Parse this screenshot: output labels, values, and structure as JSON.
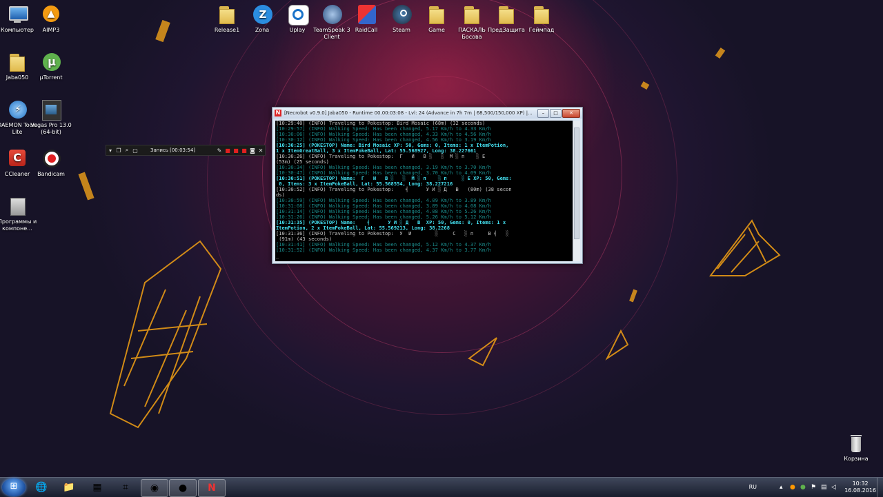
{
  "desktop": {
    "icons_left": [
      {
        "label": "Компьютер",
        "icon": "computer-icon"
      },
      {
        "label": "AIMP3",
        "icon": "aimp-icon"
      },
      {
        "label": "Jaba050",
        "icon": "folder-icon"
      },
      {
        "label": "µTorrent",
        "icon": "utorrent-icon"
      },
      {
        "label": "DAEMON Tools Lite",
        "icon": "daemon-tools-icon"
      },
      {
        "label": "Vegas Pro 13.0 (64-bit)",
        "icon": "vegas-icon"
      },
      {
        "label": "CCleaner",
        "icon": "ccleaner-icon"
      },
      {
        "label": "Bandicam",
        "icon": "bandicam-icon"
      },
      {
        "label": "Программы и компоне...",
        "icon": "programs-icon"
      }
    ],
    "icons_top": [
      {
        "label": "Release1",
        "icon": "folder-icon"
      },
      {
        "label": "Zona",
        "icon": "zona-icon"
      },
      {
        "label": "Uplay",
        "icon": "uplay-icon"
      },
      {
        "label": "TeamSpeak 3 Client",
        "icon": "teamspeak-icon"
      },
      {
        "label": "RaidCall",
        "icon": "raidcall-icon"
      },
      {
        "label": "Steam",
        "icon": "steam-icon"
      },
      {
        "label": "Game",
        "icon": "folder-icon"
      },
      {
        "label": "ПАСКАЛЬ Босова",
        "icon": "folder-icon"
      },
      {
        "label": "ПредЗащита",
        "icon": "folder-icon"
      },
      {
        "label": "Геймпад",
        "icon": "folder-icon"
      }
    ],
    "recycle_bin": {
      "label": "Корзина"
    }
  },
  "console_window": {
    "title": "[Necrobot v0.9.0] Jaba050 - Runtime 00.00:03:08 - Lvl: 24 (Advance in 7h 7m | 68,500/150,000 XP) |...",
    "lines": [
      {
        "text": "[10:29:40] (INFO) Traveling to Pokestop: Bird Mosaic (68m) (32 seconds)",
        "color": "white"
      },
      {
        "text": "[10:29:57] (INFO) Walking Speed: Has been changed, 5.17 Km/h to 4.33 Km/h",
        "color": "teal"
      },
      {
        "text": "[10:30:06] (INFO) Walking Speed: Has been changed, 4.33 Km/h to 4.56 Km/h",
        "color": "teal"
      },
      {
        "text": "[10:30:12] (INFO) Walking Speed: Has been changed, 4.56 Km/h to 3.19 Km/h",
        "color": "teal"
      },
      {
        "text": "[10:30:25] (POKESTOP) Name: Bird Mosaic XP: 50, Gems: 0, Items: 1 x ItemPotion,",
        "color": "cyan"
      },
      {
        "text": "1 x ItemGreatBall, 3 x ItemPokeBall, Lat: 55.568927, Long: 38.227661",
        "color": "cyan"
      },
      {
        "text": "[10:30:26] (INFO) Traveling to Pokestop:  Г   И   В ░   ░  М ░ п    ░ Е",
        "color": "white"
      },
      {
        "text": "(53m) (25 seconds)",
        "color": "white"
      },
      {
        "text": "[10:30:34] (INFO) Walking Speed: Has been changed, 3.19 Km/h to 3.70 Km/h",
        "color": "teal"
      },
      {
        "text": "[10:30:47] (INFO) Walking Speed: Has been changed, 3.70 Km/h to 4.09 Km/h",
        "color": "teal"
      },
      {
        "text": "[10:30:51] (POKESTOP) Name:  Г   И   В ░   ░  М ░ п    ░ п     ░ Е XP: 50, Gems:",
        "color": "cyan"
      },
      {
        "text": " 0, Items: 3 x ItemPokeBall, Lat: 55.568554, Long: 38.227216",
        "color": "cyan"
      },
      {
        "text": "[10:30:52] (INFO) Traveling to Pokestop:    ╡      У И ░ Д   В   (80m) (38 secon",
        "color": "white"
      },
      {
        "text": "ds)",
        "color": "white"
      },
      {
        "text": "[10:30:59] (INFO) Walking Speed: Has been changed, 4.09 Km/h to 3.89 Km/h",
        "color": "teal"
      },
      {
        "text": "[10:31:08] (INFO) Walking Speed: Has been changed, 3.89 Km/h to 4.08 Km/h",
        "color": "teal"
      },
      {
        "text": "[10:31:14] (INFO) Walking Speed: Has been changed, 4.08 Km/h to 5.26 Km/h",
        "color": "teal"
      },
      {
        "text": "[10:31:26] (INFO) Walking Speed: Has been changed, 5.26 Km/h to 5.12 Km/h",
        "color": "teal"
      },
      {
        "text": "[10:31:35] (POKESTOP) Name:    ╡      У И ░ Д   В  XP: 50, Gems: 0, Items: 1 x",
        "color": "cyan"
      },
      {
        "text": "ItemPotion, 2 x ItemPokeBall, Lat: 55.569213, Long: 38.2268",
        "color": "cyan"
      },
      {
        "text": "[10:31:36] (INFO) Traveling to Pokestop:  У  И        ░     С   ░ п     В ╡   ░",
        "color": "white"
      },
      {
        "text": " (91m) (43 seconds)",
        "color": "white"
      },
      {
        "text": "[10:31:41] (INFO) Walking Speed: Has been changed, 5.12 Km/h to 4.37 Km/h",
        "color": "teal"
      },
      {
        "text": "[10:31:52] (INFO) Walking Speed: Has been changed, 4.37 Km/h to 3.77 Km/h",
        "color": "teal"
      },
      {
        "text": "_",
        "color": "white"
      }
    ]
  },
  "record_toolbar": {
    "label": "Запись [00:03:54]"
  },
  "taskbar": {
    "items": [
      "windows-explorer-icon",
      "media-player-icon",
      "folder-icon",
      "task-manager-icon",
      "vegas-icon",
      "chrome-icon",
      "bandicam-icon",
      "necrobot-icon"
    ],
    "language": "RU",
    "time": "10:32",
    "date": "16.08.2016"
  },
  "colors": {
    "console_white": "#c8c8c8",
    "console_teal": "#1a8a8a",
    "console_cyan": "#44e0f0",
    "accent": "#f3a81a"
  }
}
